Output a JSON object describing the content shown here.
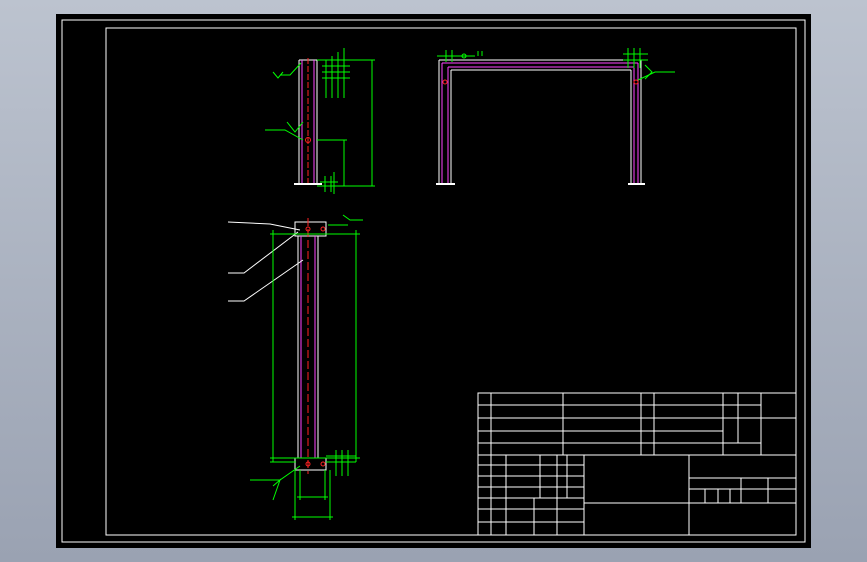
{
  "colors": {
    "background": "#a8b0be",
    "sheet": "#000000",
    "frame": "#ffffff",
    "dimension": "#00ff00",
    "part_outline": "#ff44ff",
    "centerline": "#ff2222"
  },
  "dimension_labels": {
    "top_left_arrow": "▽",
    "top_right_arrow": "▽",
    "flag_left": "⊏",
    "flag_bottom": "⊏"
  }
}
